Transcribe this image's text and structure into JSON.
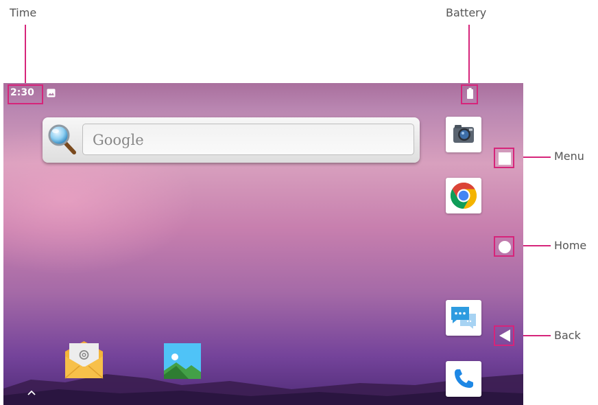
{
  "callouts": {
    "time": "Time",
    "battery": "Battery",
    "menu": "Menu",
    "home": "Home",
    "back": "Back"
  },
  "statusbar": {
    "time": "2:30",
    "notification_icon": "image-icon",
    "battery_icon": "battery-icon"
  },
  "search": {
    "placeholder": "Google",
    "icon": "magnifier-icon"
  },
  "apps": [
    {
      "name": "Camera",
      "icon": "camera-icon"
    },
    {
      "name": "Chrome",
      "icon": "chrome-icon"
    },
    {
      "name": "Messages",
      "icon": "messages-icon"
    },
    {
      "name": "Phone",
      "icon": "phone-icon"
    },
    {
      "name": "Email",
      "icon": "email-icon"
    },
    {
      "name": "Gallery",
      "icon": "gallery-icon"
    }
  ],
  "navigation": {
    "menu_icon": "square-icon",
    "home_icon": "circle-icon",
    "back_icon": "triangle-back-icon",
    "app_drawer_icon": "chevron-up-icon"
  },
  "colors": {
    "highlight": "#d6247a"
  }
}
